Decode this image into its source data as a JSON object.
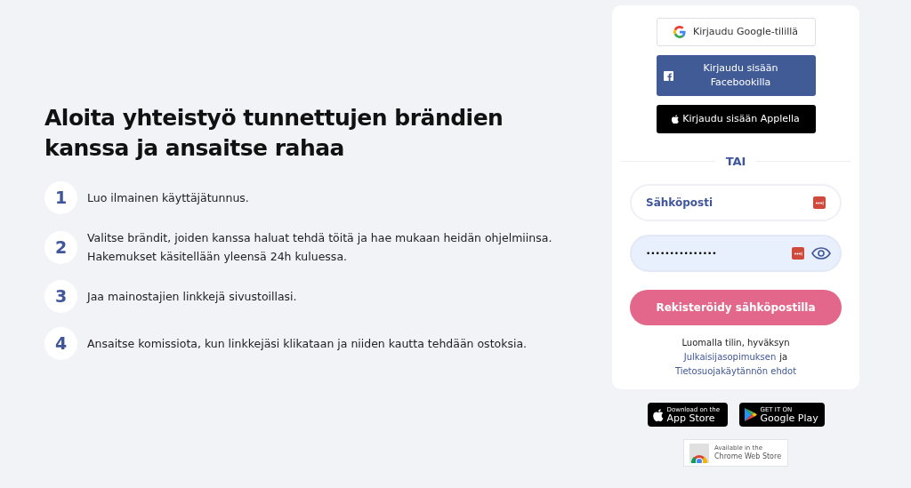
{
  "headline": "Aloita yhteistyö tunnettujen brändien kanssa ja ansaitse rahaa",
  "steps": [
    {
      "number": "1",
      "lines": [
        "Luo ilmainen käyttäjätunnus."
      ]
    },
    {
      "number": "2",
      "lines": [
        "Valitse brändit, joiden kanssa haluat tehdä töitä ja hae mukaan heidän ohjelmiinsa.",
        "Hakemukset käsitellään yleensä 24h kuluessa."
      ]
    },
    {
      "number": "3",
      "lines": [
        "Jaa mainostajien linkkejä sivustoillasi."
      ]
    },
    {
      "number": "4",
      "lines": [
        "Ansaitse komissiota, kun linkkejäsi klikataan ja niiden kautta tehdään ostoksia."
      ]
    }
  ],
  "signup": {
    "social_buttons": [
      {
        "kind": "google",
        "label": "Kirjaudu Google-tilillä"
      },
      {
        "kind": "facebook",
        "label": "Kirjaudu sisään Facebookilla"
      },
      {
        "kind": "apple",
        "label": "Kirjaudu sisään Applella"
      }
    ],
    "divider": "TAI",
    "email": {
      "placeholder": "Sähköposti"
    },
    "password": {
      "value": "•••••••••••••••"
    },
    "submit": "Rekisteröidy sähköpostilla",
    "legal": {
      "text": "Luomalla tilin, hyväksyn",
      "link1": "Julkaisijasopimuksen",
      "conjunction": "ja",
      "link2": "Tietosuojakäytännön ehdot"
    }
  },
  "badges": [
    {
      "kind": "appstore",
      "small": "Download on the",
      "big": "App Store"
    },
    {
      "kind": "googleplay",
      "small": "GET IT ON",
      "big": "Google Play"
    },
    {
      "kind": "chrome",
      "small": "Available in the",
      "big": "Chrome Web Store"
    }
  ]
}
